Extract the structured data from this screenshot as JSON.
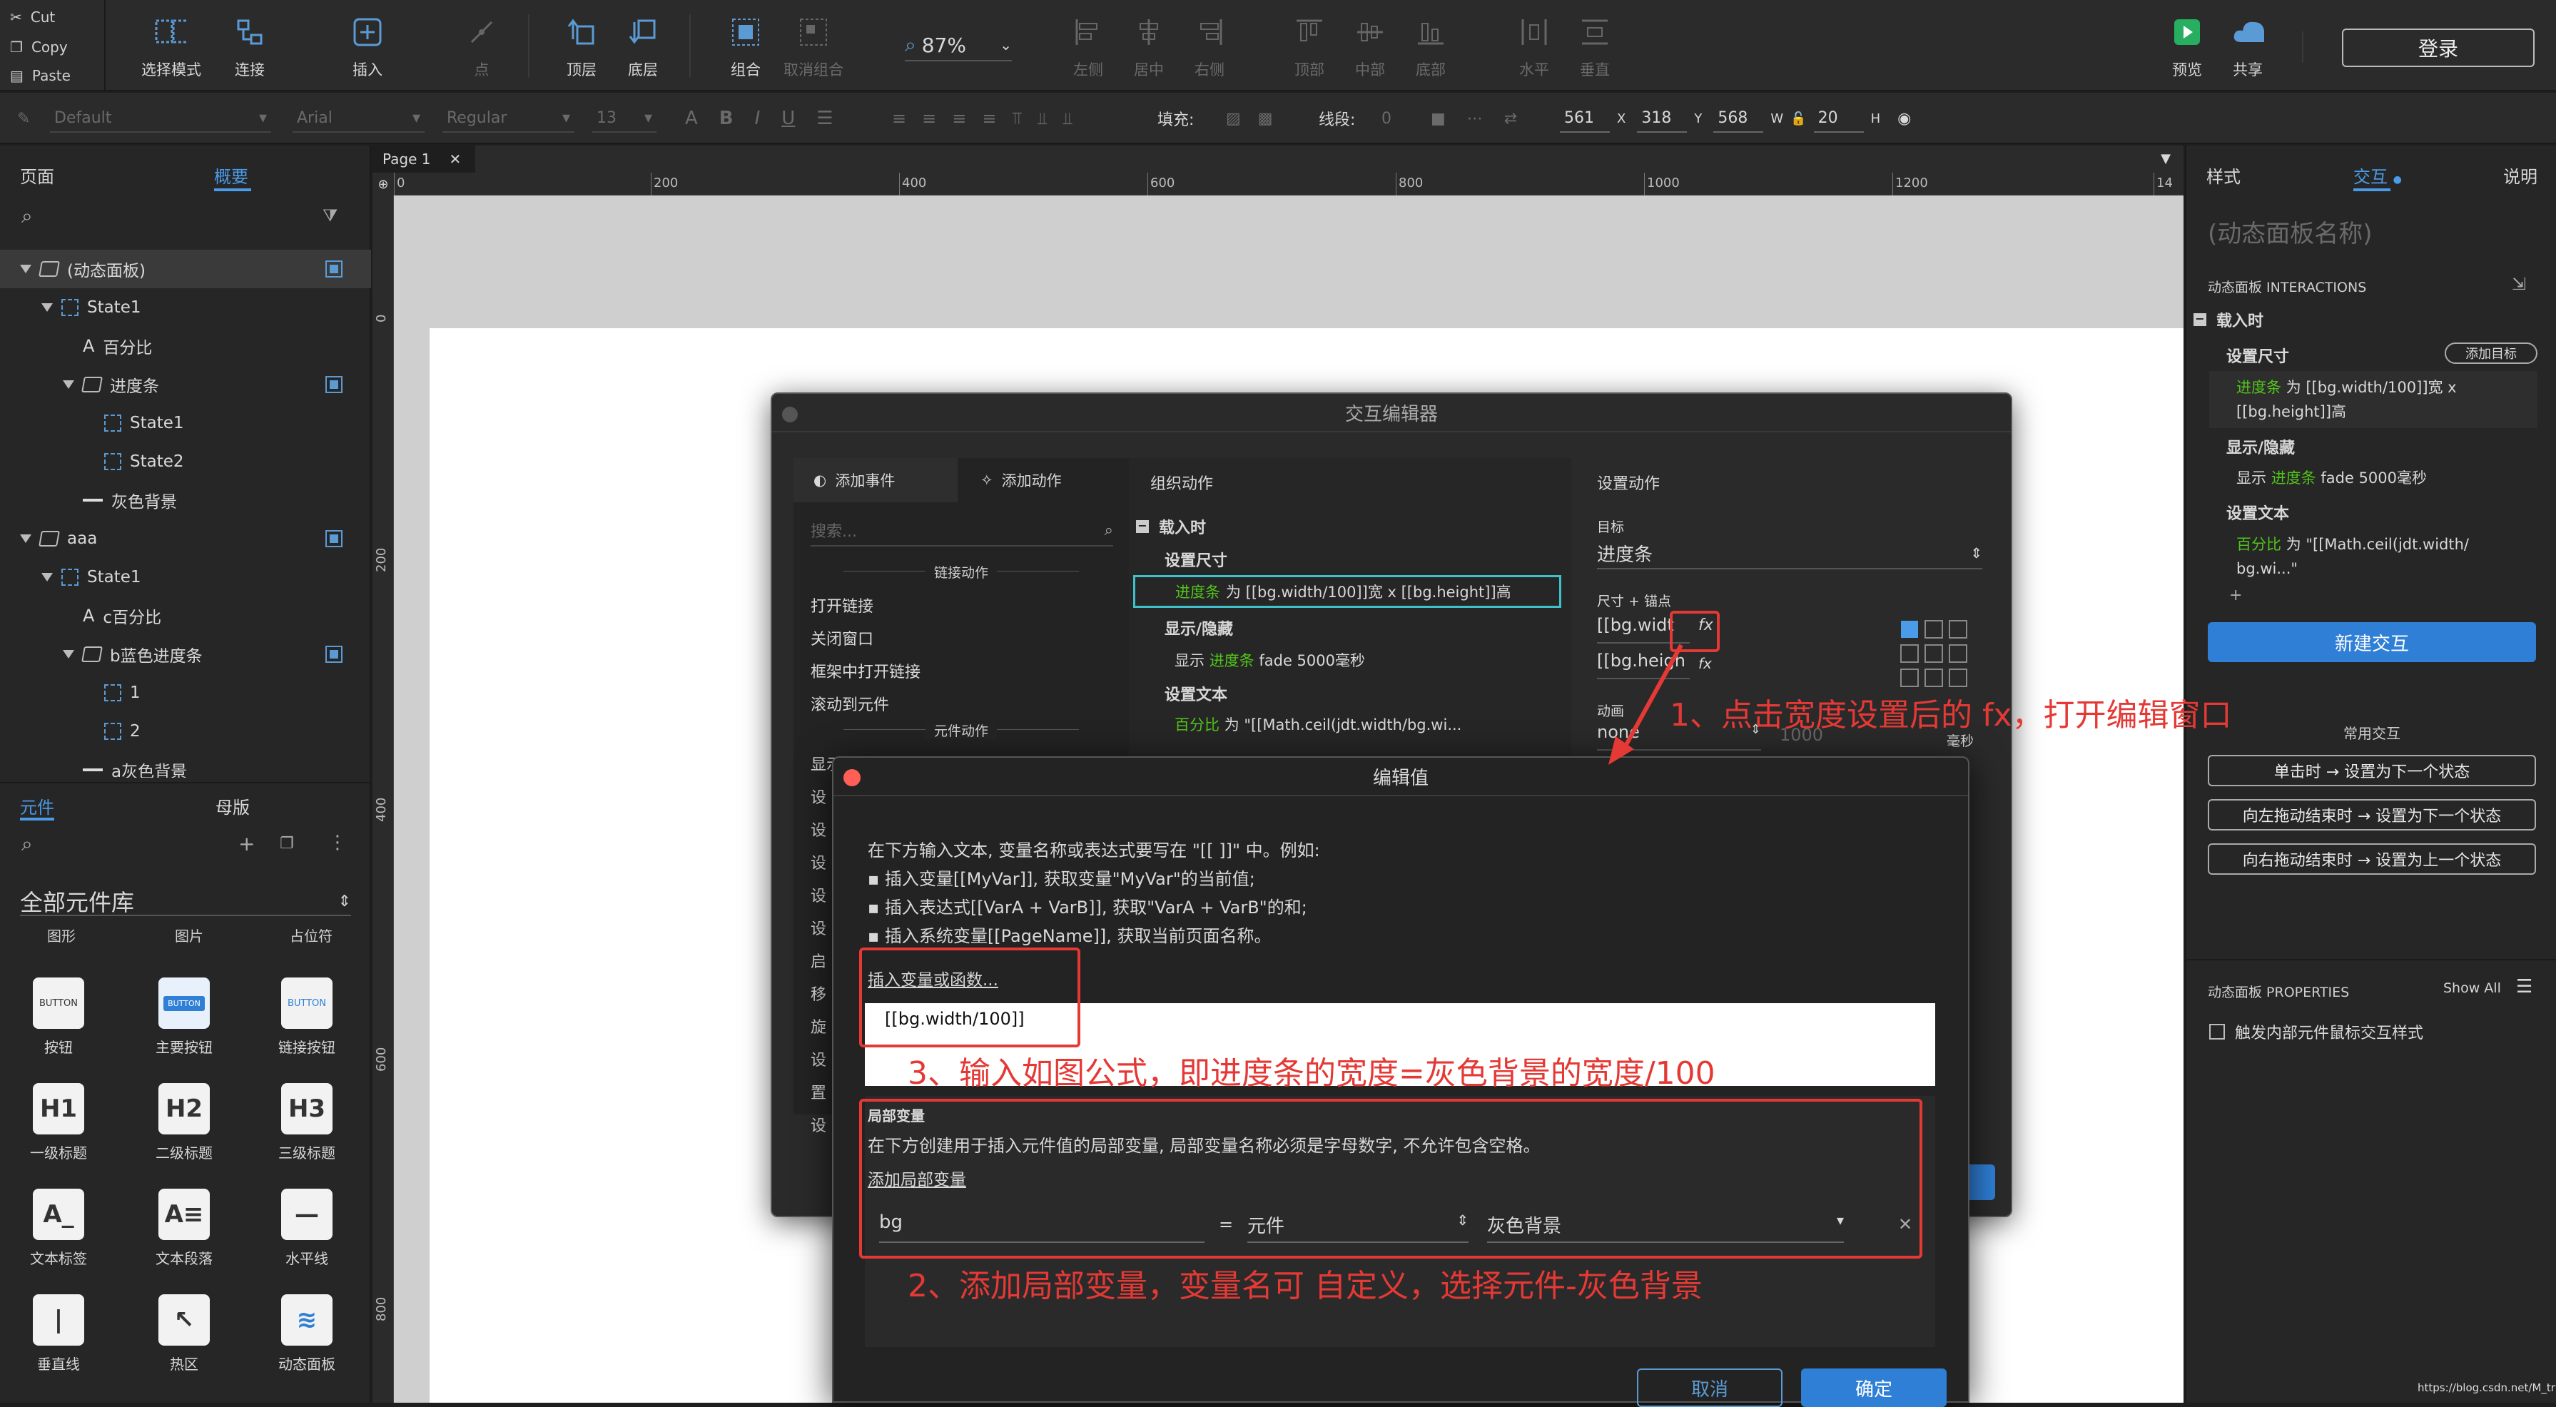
{
  "edit": {
    "cut": "Cut",
    "copy": "Copy",
    "paste": "Paste"
  },
  "toolbar": {
    "select_mode": "选择模式",
    "connect": "连接",
    "insert": "插入",
    "point": "点",
    "top": "顶层",
    "bottom": "底层",
    "group": "组合",
    "ungroup": "取消组合",
    "zoom": "87%",
    "align_left": "左侧",
    "align_center": "居中",
    "align_right": "右侧",
    "align_top": "顶部",
    "align_middle": "中部",
    "align_bottom": "底部",
    "dist_h": "水平",
    "dist_v": "垂直",
    "preview": "预览",
    "share": "共享",
    "login": "登录"
  },
  "format": {
    "style": "Default",
    "font": "Arial",
    "weight": "Regular",
    "size": "13",
    "fill_label": "填充:",
    "line_label": "线段:",
    "line_value": "0",
    "x": "561",
    "x_label": "X",
    "y": "318",
    "y_label": "Y",
    "w": "568",
    "w_label": "W",
    "h": "20",
    "h_label": "H"
  },
  "left": {
    "tab_pages": "页面",
    "tab_outline": "概要",
    "outline": [
      {
        "label": "(动态面板)",
        "kind": "panel",
        "indent": 0,
        "check": true
      },
      {
        "label": "State1",
        "kind": "state",
        "indent": 1,
        "check": false
      },
      {
        "label": "百分比",
        "kind": "text",
        "indent": 2,
        "check": false
      },
      {
        "label": "进度条",
        "kind": "panel",
        "indent": 2,
        "check": true
      },
      {
        "label": "State1",
        "kind": "state",
        "indent": 3,
        "check": false
      },
      {
        "label": "State2",
        "kind": "state",
        "indent": 3,
        "check": false
      },
      {
        "label": "灰色背景",
        "kind": "line",
        "indent": 2,
        "check": false
      },
      {
        "label": "aaa",
        "kind": "panel",
        "indent": 0,
        "check": true
      },
      {
        "label": "State1",
        "kind": "state",
        "indent": 1,
        "check": false
      },
      {
        "label": "c百分比",
        "kind": "text",
        "indent": 2,
        "check": false
      },
      {
        "label": "b蓝色进度条",
        "kind": "panel",
        "indent": 2,
        "check": true
      },
      {
        "label": "1",
        "kind": "state",
        "indent": 3,
        "check": false
      },
      {
        "label": "2",
        "kind": "state",
        "indent": 3,
        "check": false
      },
      {
        "label": "a灰色背景",
        "kind": "line",
        "indent": 2,
        "check": false
      }
    ],
    "tab_widgets": "元件",
    "tab_masters": "母版",
    "library": "全部元件库",
    "cats": [
      "图形",
      "图片",
      "占位符"
    ],
    "widgets": [
      {
        "label": "按钮",
        "icon": "BUTTON"
      },
      {
        "label": "主要按钮",
        "icon": "BUTTON"
      },
      {
        "label": "链接按钮",
        "icon": "BUTTON"
      },
      {
        "label": "一级标题",
        "icon": "H1"
      },
      {
        "label": "二级标题",
        "icon": "H2"
      },
      {
        "label": "三级标题",
        "icon": "H3"
      },
      {
        "label": "文本标签",
        "icon": "A_"
      },
      {
        "label": "文本段落",
        "icon": "A≡"
      },
      {
        "label": "水平线",
        "icon": "—"
      },
      {
        "label": "垂直线",
        "icon": "|"
      },
      {
        "label": "热区",
        "icon": "↖"
      },
      {
        "label": "动态面板",
        "icon": "≋"
      }
    ]
  },
  "canvas": {
    "tab": "Page 1",
    "ruler_h": [
      "0",
      "200",
      "400",
      "600",
      "800",
      "1000",
      "1200",
      "14"
    ],
    "ruler_v": [
      "0",
      "200",
      "400",
      "600",
      "800"
    ]
  },
  "right": {
    "tab_style": "样式",
    "tab_interact": "交互",
    "tab_notes": "说明",
    "panel_name": "(动态面板名称)",
    "interactions_title": "动态面板 INTERACTIONS",
    "event": "载入时",
    "action1": "设置尺寸",
    "add_target": "添加目标",
    "a1_target": "进度条",
    "a1_text": "为 [[bg.width/100]]宽 x",
    "a1_text2": "[[bg.height]]高",
    "action2": "显示/隐藏",
    "a2_pre": "显示",
    "a2_target": "进度条",
    "a2_text": "fade 5000毫秒",
    "action3": "设置文本",
    "a3_target": "百分比",
    "a3_text": "为 \"[[Math.ceil(jdt.width/",
    "a3_text2": "bg.wi...\"",
    "plus": "+",
    "new_interaction": "新建交互",
    "common": "常用交互",
    "common_items": [
      "单击时 → 设置为下一个状态",
      "向左拖动结束时 → 设置为下一个状态",
      "向右拖动结束时 → 设置为上一个状态"
    ],
    "props_title": "动态面板 PROPERTIES",
    "show_all": "Show All",
    "prop_check": "触发内部元件鼠标交互样式"
  },
  "interaction_editor": {
    "title": "交互编辑器",
    "tab_event": "添加事件",
    "tab_action": "添加动作",
    "search": "搜索...",
    "sec_link": "链接动作",
    "link_actions": [
      "打开链接",
      "关闭窗口",
      "框架中打开链接",
      "滚动到元件"
    ],
    "sec_widget": "元件动作",
    "widget_actions": [
      "显示/隐藏",
      "设",
      "设",
      "设",
      "设",
      "设",
      "启",
      "移",
      "旋",
      "设",
      "置",
      "设"
    ],
    "org_title": "组织动作",
    "org_event": "载入时",
    "org_a1": "设置尺寸",
    "org_a1_target": "进度条",
    "org_a1_text": "为 [[bg.width/100]]宽 x [[bg.height]]高",
    "org_a2": "显示/隐藏",
    "org_a2_pre": "显示",
    "org_a2_target": "进度条",
    "org_a2_text": "fade 5000毫秒",
    "org_a3": "设置文本",
    "org_a3_target": "百分比",
    "org_a3_text": "为 \"[[Math.ceil(jdt.width/bg.wi...",
    "set_title": "设置动作",
    "target_label": "目标",
    "target_value": "进度条",
    "size_label": "尺寸 + 锚点",
    "w_value": "[[bg.widt",
    "h_value": "[[bg.heigh",
    "fx": "fx",
    "anim_label": "动画",
    "anim_value": "none",
    "anim_ms": "1000",
    "anim_unit": "毫秒"
  },
  "edit_value": {
    "title": "编辑值",
    "intro": "在下方输入文本, 变量名称或表达式要写在 \"[[ ]]\" 中。例如:",
    "b1": "▪ 插入变量[[MyVar]], 获取变量\"MyVar\"的当前值;",
    "b2": "▪ 插入表达式[[VarA + VarB]], 获取\"VarA + VarB\"的和;",
    "b3": "▪ 插入系统变量[[PageName]], 获取当前页面名称。",
    "insert_link": "插入变量或函数...",
    "expr": "[[bg.width/100]]",
    "local_title": "局部变量",
    "local_desc": "在下方创建用于插入元件值的局部变量, 局部变量名称必须是字母数字, 不允许包含空格。",
    "add_local": "添加局部变量",
    "var_name": "bg",
    "eq": "=",
    "var_type": "元件",
    "var_widget": "灰色背景",
    "cancel": "取消",
    "ok": "确定"
  },
  "annotations": {
    "a1": "1、点击宽度设置后的 fx，打开编辑窗口",
    "a2": "2、添加局部变量，变量名可 自定义，选择元件-灰色背景",
    "a3": "3、输入如图公式，即进度条的宽度=灰色背景的宽度/100"
  },
  "watermark": "https://blog.csdn.net/M_try"
}
